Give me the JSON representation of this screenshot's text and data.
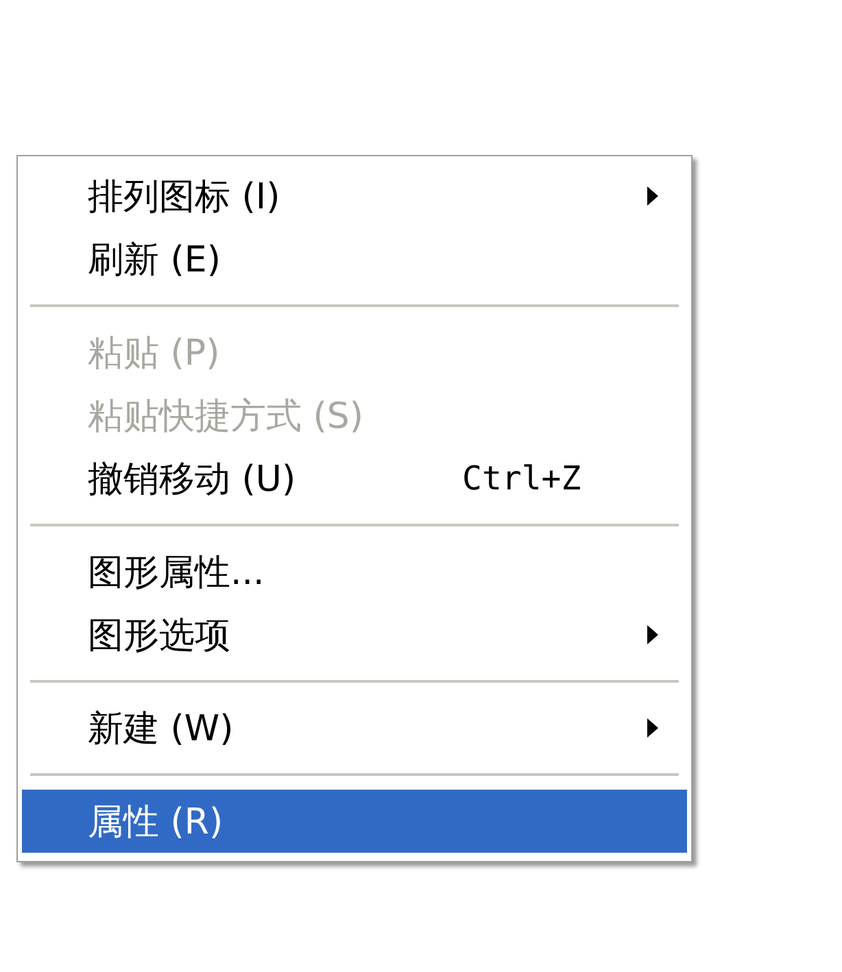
{
  "context_menu": {
    "items": [
      {
        "kind": "item",
        "label": "排列图标 (I)",
        "submenu": true,
        "disabled": false,
        "selected": false
      },
      {
        "kind": "item",
        "label": "刷新 (E)",
        "submenu": false,
        "disabled": false,
        "selected": false
      },
      {
        "kind": "separator"
      },
      {
        "kind": "item",
        "label": "粘贴 (P)",
        "submenu": false,
        "disabled": true,
        "selected": false
      },
      {
        "kind": "item",
        "label": "粘贴快捷方式 (S)",
        "submenu": false,
        "disabled": true,
        "selected": false
      },
      {
        "kind": "item",
        "label": "撤销移动 (U)",
        "shortcut": "Ctrl+Z",
        "submenu": false,
        "disabled": false,
        "selected": false
      },
      {
        "kind": "separator"
      },
      {
        "kind": "item",
        "label": "图形属性...",
        "submenu": false,
        "disabled": false,
        "selected": false
      },
      {
        "kind": "item",
        "label": "图形选项",
        "submenu": true,
        "disabled": false,
        "selected": false
      },
      {
        "kind": "separator"
      },
      {
        "kind": "item",
        "label": "新建 (W)",
        "submenu": true,
        "disabled": false,
        "selected": false
      },
      {
        "kind": "separator"
      },
      {
        "kind": "item",
        "label": "属性 (R)",
        "submenu": false,
        "disabled": false,
        "selected": true
      }
    ]
  }
}
